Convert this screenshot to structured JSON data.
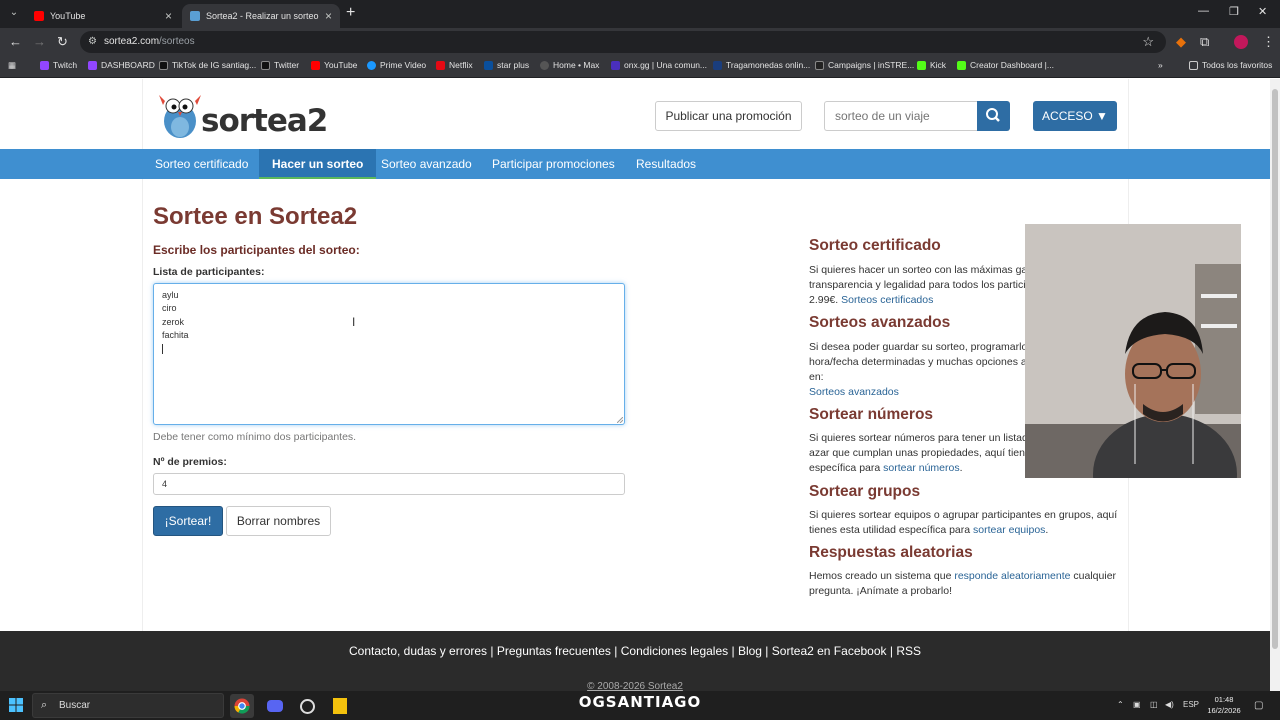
{
  "browser": {
    "tabs": [
      {
        "title": "YouTube",
        "active": false
      },
      {
        "title": "Sortea2 - Realizar un sorteo",
        "active": true
      }
    ],
    "url_domain": "sortea2.com",
    "url_path": "/sorteos",
    "bookmarks": [
      {
        "label": "Twitch",
        "color": "#9146ff"
      },
      {
        "label": "DASHBOARD",
        "color": "#9146ff"
      },
      {
        "label": "TikTok de IG santiag...",
        "color": "#000000"
      },
      {
        "label": "Twitter",
        "color": "#000000"
      },
      {
        "label": "YouTube",
        "color": "#ff0000"
      },
      {
        "label": "Prime Video",
        "color": "#1a98ff"
      },
      {
        "label": "Netflix",
        "color": "#e50914"
      },
      {
        "label": "star plus",
        "color": "#0a4f9c"
      },
      {
        "label": "Home • Max",
        "color": "#333333"
      },
      {
        "label": "onx.gg | Una comun...",
        "color": "#4a2fbd"
      },
      {
        "label": "Tragamonedas onlin...",
        "color": "#1a3d7c"
      },
      {
        "label": "Campaigns | inSTRE...",
        "color": "#222222"
      },
      {
        "label": "Kick",
        "color": "#53fc18"
      },
      {
        "label": "Creator Dashboard |...",
        "color": "#53fc18"
      }
    ],
    "all_bookmarks": "Todos los favoritos"
  },
  "header": {
    "logo_text": "sortea2",
    "publish_button": "Publicar una promoción",
    "search_placeholder": "sorteo de un viaje",
    "access_button": "ACCESO ▼"
  },
  "nav": {
    "items": [
      {
        "label": "Sorteo certificado",
        "active": false
      },
      {
        "label": "Hacer un sorteo",
        "active": true
      },
      {
        "label": "Sorteo avanzado",
        "active": false
      },
      {
        "label": "Participar promociones",
        "active": false
      },
      {
        "label": "Resultados",
        "active": false
      }
    ]
  },
  "form": {
    "title": "Sortee en Sortea2",
    "subtitle": "Escribe los participantes del sorteo:",
    "participants_label": "Lista de participantes:",
    "participants": [
      "aylu",
      "ciro",
      "zerok",
      "fachita"
    ],
    "hint": "Debe tener como mínimo dos participantes.",
    "prizes_label": "Nº de premios:",
    "prizes_value": "4",
    "submit_button": "¡Sortear!",
    "clear_button": "Borrar nombres"
  },
  "sidebar": {
    "sections": [
      {
        "title": "Sorteo certificado",
        "text_lines": [
          "Si quieres hacer un sorteo con las máximas gara",
          "transparencia y legalidad para todos los partici",
          "2.99€. "
        ],
        "link": "Sorteos certificados",
        "suffix": ""
      },
      {
        "title": "Sorteos avanzados",
        "text_lines": [
          "Si desea poder guardar su sorteo, programarlo",
          "hora/fecha determinadas y muchas opciones av",
          "en:"
        ],
        "link": "Sorteos avanzados",
        "suffix": ""
      },
      {
        "title": "Sortear números",
        "text_lines": [
          "Si quieres sortear números para tener un listad",
          "azar que cumplan unas propiedades, aquí tiene",
          "específica para "
        ],
        "link": "sortear números",
        "suffix": "."
      },
      {
        "title": "Sortear grupos",
        "text_lines": [
          "Si quieres sortear equipos o agrupar participantes en grupos, aquí",
          "tienes esta utilidad específica para "
        ],
        "link": "sortear equipos",
        "suffix": "."
      },
      {
        "title": "Respuestas aleatorias",
        "text_lines": [
          "Hemos creado un sistema que "
        ],
        "link": "responde aleatoriamente",
        "suffix": " cualquier",
        "after_lines": [
          "pregunta. ¡Anímate a probarlo!"
        ]
      }
    ]
  },
  "footer": {
    "links": [
      "Contacto, dudas y errores",
      "Preguntas frecuentes",
      "Condiciones legales",
      "Blog",
      "Sortea2 en Facebook",
      "RSS"
    ],
    "copyright": "© 2008-2026 Sortea2",
    "watermark": "OGSANTIAGO"
  },
  "taskbar": {
    "search_placeholder": "Buscar",
    "language": "ESP",
    "time": "01:48",
    "date": "16/2/2026"
  },
  "colors": {
    "nav_bg": "#3f8fd0",
    "primary_button": "#2e6da4",
    "heading": "#7a3a32",
    "link": "#2a6496"
  }
}
